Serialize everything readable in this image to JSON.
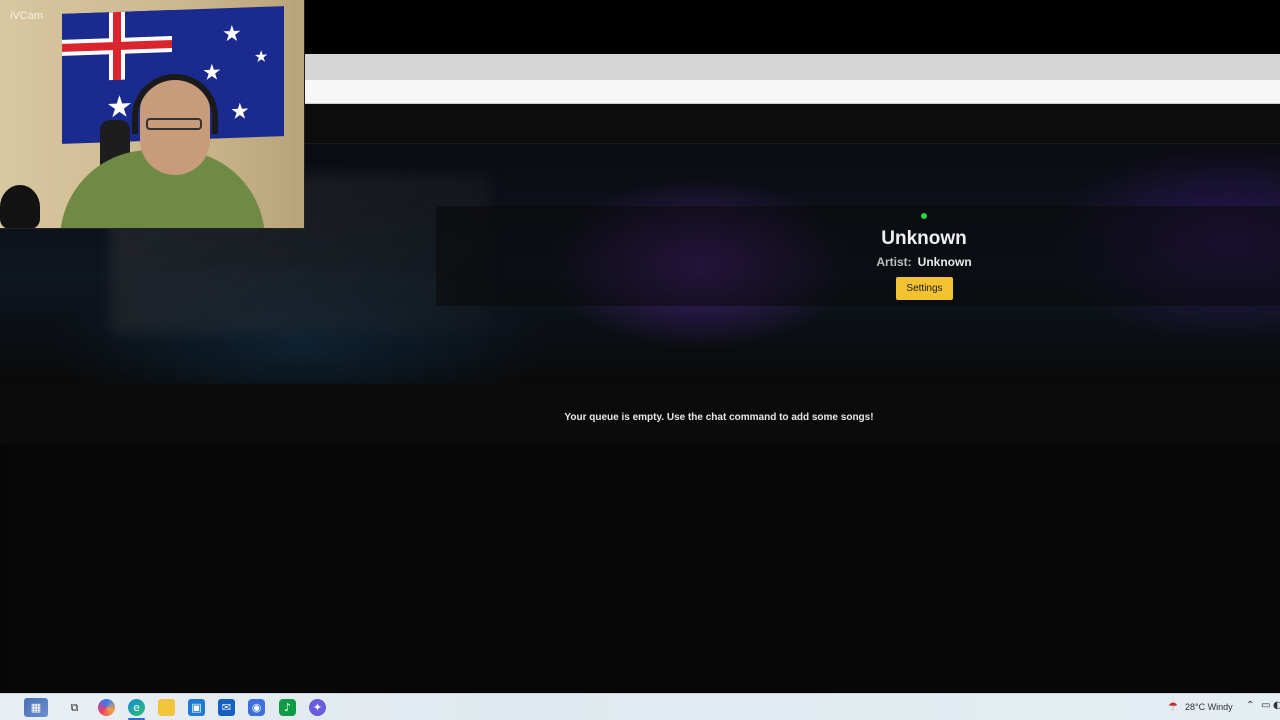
{
  "webcam": {
    "label": "iVCam"
  },
  "now_playing": {
    "title": "Unknown",
    "artist_label": "Artist:",
    "artist": "Unknown",
    "settings_label": "Settings",
    "status_color": "#27d645"
  },
  "queue": {
    "empty_message": "Your queue is empty. Use the chat command to add some songs!"
  },
  "taskbar": {
    "icons": [
      "start-icon",
      "task-view-icon",
      "copilot-icon",
      "edge-icon",
      "file-explorer-icon",
      "store-icon",
      "outlook-icon",
      "app-icon",
      "spotify-like-icon",
      "messenger-icon"
    ],
    "weather": "28°C  Windy"
  },
  "colors": {
    "accent": "#f2c230",
    "background": "#060606"
  }
}
